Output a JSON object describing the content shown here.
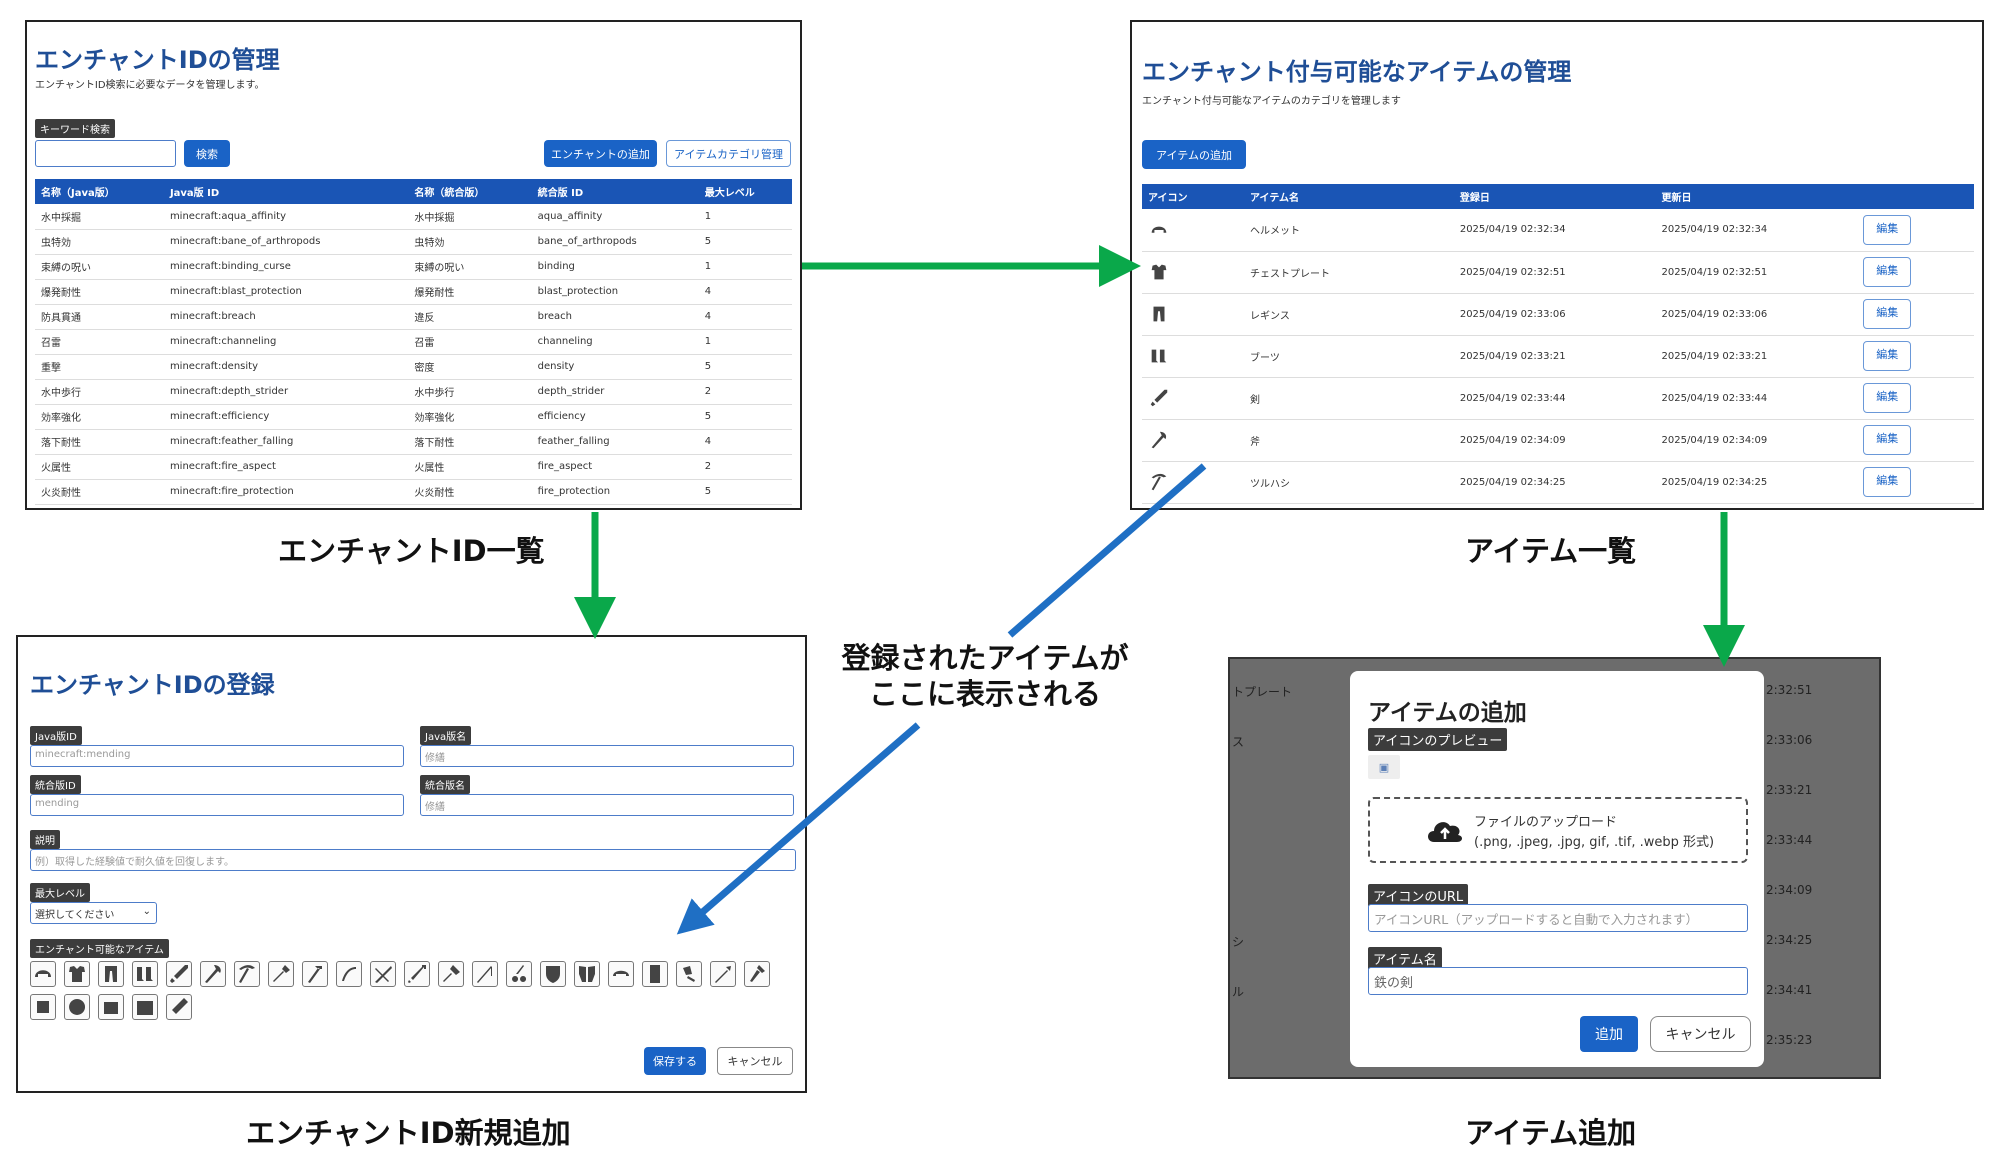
{
  "colors": {
    "primary": "#1a55b5",
    "button": "#1a63c6",
    "arrow_green": "#0aa84a",
    "arrow_blue": "#1f6fc4",
    "dark_tag": "#3c3c3c"
  },
  "enchant_list": {
    "title": "エンチャントIDの管理",
    "subtitle": "エンチャントID検索に必要なデータを管理します。",
    "keyword_label": "キーワード検索",
    "search_button": "検索",
    "add_button": "エンチャントの追加",
    "category_button": "アイテムカテゴリ管理",
    "columns": [
      "名称（Java版）",
      "Java版 ID",
      "名称（統合版）",
      "統合版 ID",
      "最大レベル"
    ],
    "rows": [
      [
        "水中採掘",
        "minecraft:aqua_affinity",
        "水中採掘",
        "aqua_affinity",
        "1"
      ],
      [
        "虫特効",
        "minecraft:bane_of_arthropods",
        "虫特効",
        "bane_of_arthropods",
        "5"
      ],
      [
        "束縛の呪い",
        "minecraft:binding_curse",
        "束縛の呪い",
        "binding",
        "1"
      ],
      [
        "爆発耐性",
        "minecraft:blast_protection",
        "爆発耐性",
        "blast_protection",
        "4"
      ],
      [
        "防具貫通",
        "minecraft:breach",
        "違反",
        "breach",
        "4"
      ],
      [
        "召雷",
        "minecraft:channeling",
        "召雷",
        "channeling",
        "1"
      ],
      [
        "重撃",
        "minecraft:density",
        "密度",
        "density",
        "5"
      ],
      [
        "水中歩行",
        "minecraft:depth_strider",
        "水中歩行",
        "depth_strider",
        "2"
      ],
      [
        "効率強化",
        "minecraft:efficiency",
        "効率強化",
        "efficiency",
        "5"
      ],
      [
        "落下耐性",
        "minecraft:feather_falling",
        "落下耐性",
        "feather_falling",
        "4"
      ],
      [
        "火属性",
        "minecraft:fire_aspect",
        "火属性",
        "fire_aspect",
        "2"
      ],
      [
        "火炎耐性",
        "minecraft:fire_protection",
        "火炎耐性",
        "fire_protection",
        "5"
      ]
    ],
    "caption": "エンチャントID一覧"
  },
  "item_list": {
    "title": "エンチャント付与可能なアイテムの管理",
    "subtitle": "エンチャント付与可能なアイテムのカテゴリを管理します",
    "add_button": "アイテムの追加",
    "columns": [
      "アイコン",
      "アイテム名",
      "登録日",
      "更新日",
      ""
    ],
    "rows": [
      {
        "icon": "helmet-icon",
        "name": "ヘルメット",
        "created": "2025/04/19 02:32:34",
        "updated": "2025/04/19 02:32:34"
      },
      {
        "icon": "chestplate-icon",
        "name": "チェストプレート",
        "created": "2025/04/19 02:32:51",
        "updated": "2025/04/19 02:32:51"
      },
      {
        "icon": "leggings-icon",
        "name": "レギンス",
        "created": "2025/04/19 02:33:06",
        "updated": "2025/04/19 02:33:06"
      },
      {
        "icon": "boots-icon",
        "name": "ブーツ",
        "created": "2025/04/19 02:33:21",
        "updated": "2025/04/19 02:33:21"
      },
      {
        "icon": "sword-icon",
        "name": "剣",
        "created": "2025/04/19 02:33:44",
        "updated": "2025/04/19 02:33:44"
      },
      {
        "icon": "axe-icon",
        "name": "斧",
        "created": "2025/04/19 02:34:09",
        "updated": "2025/04/19 02:34:09"
      },
      {
        "icon": "pickaxe-icon",
        "name": "ツルハシ",
        "created": "2025/04/19 02:34:25",
        "updated": "2025/04/19 02:34:25"
      }
    ],
    "edit_label": "編集",
    "caption": "アイテム一覧"
  },
  "enchant_form": {
    "title": "エンチャントIDの登録",
    "java_id_label": "Java版ID",
    "java_id_placeholder": "minecraft:mending",
    "java_name_label": "Java版名",
    "java_name_placeholder": "修繕",
    "bedrock_id_label": "統合版ID",
    "bedrock_id_placeholder": "mending",
    "bedrock_name_label": "統合版名",
    "bedrock_name_placeholder": "修繕",
    "desc_label": "説明",
    "desc_placeholder": "例）取得した経験値で耐久値を回復します。",
    "max_level_label": "最大レベル",
    "max_level_value": "選択してください",
    "items_label": "エンチャント可能なアイテム",
    "item_icons": [
      "helmet-icon",
      "chestplate-icon",
      "leggings-icon",
      "boots-icon",
      "sword-icon",
      "axe-icon",
      "pickaxe-icon",
      "shovel-icon",
      "hoe-icon",
      "bow-icon",
      "crossbow-icon",
      "trident-icon",
      "mace-icon",
      "fishing-rod-icon",
      "shears-icon",
      "shield-icon",
      "elytra-icon",
      "turtle-shell-icon",
      "book-icon",
      "flint-and-steel-icon",
      "carrot-on-stick-icon",
      "brush-icon",
      "head-icon",
      "compass-icon",
      "pumpkin-icon",
      "chest-icon",
      "spear-icon"
    ],
    "save_button": "保存する",
    "cancel_button": "キャンセル",
    "caption": "エンチャントID新規追加"
  },
  "item_add": {
    "bg_rows": [
      {
        "left": "トプレート",
        "right": "2:32:51"
      },
      {
        "left": "ス",
        "right": "2:33:06"
      },
      {
        "left": "",
        "right": "2:33:21"
      },
      {
        "left": "",
        "right": "2:33:44"
      },
      {
        "left": "",
        "right": "2:34:09"
      },
      {
        "left": "シ",
        "right": "2:34:25"
      },
      {
        "left": "ル",
        "right": "2:34:41"
      },
      {
        "left": "",
        "right": "2:35:23"
      }
    ],
    "title": "アイテムの追加",
    "preview_label": "アイコンのプレビュー",
    "upload_line1": "ファイルのアップロード",
    "upload_line2": "(.png, .jpeg, .jpg, gif, .tif, .webp 形式)",
    "url_label": "アイコンのURL",
    "url_placeholder": "アイコンURL（アップロードすると自動で入力されます）",
    "name_label": "アイテム名",
    "name_value": "鉄の剣",
    "add_button": "追加",
    "cancel_button": "キャンセル",
    "caption": "アイテム追加"
  },
  "annotation": {
    "line1": "登録されたアイテムが",
    "line2": "ここに表示される"
  }
}
